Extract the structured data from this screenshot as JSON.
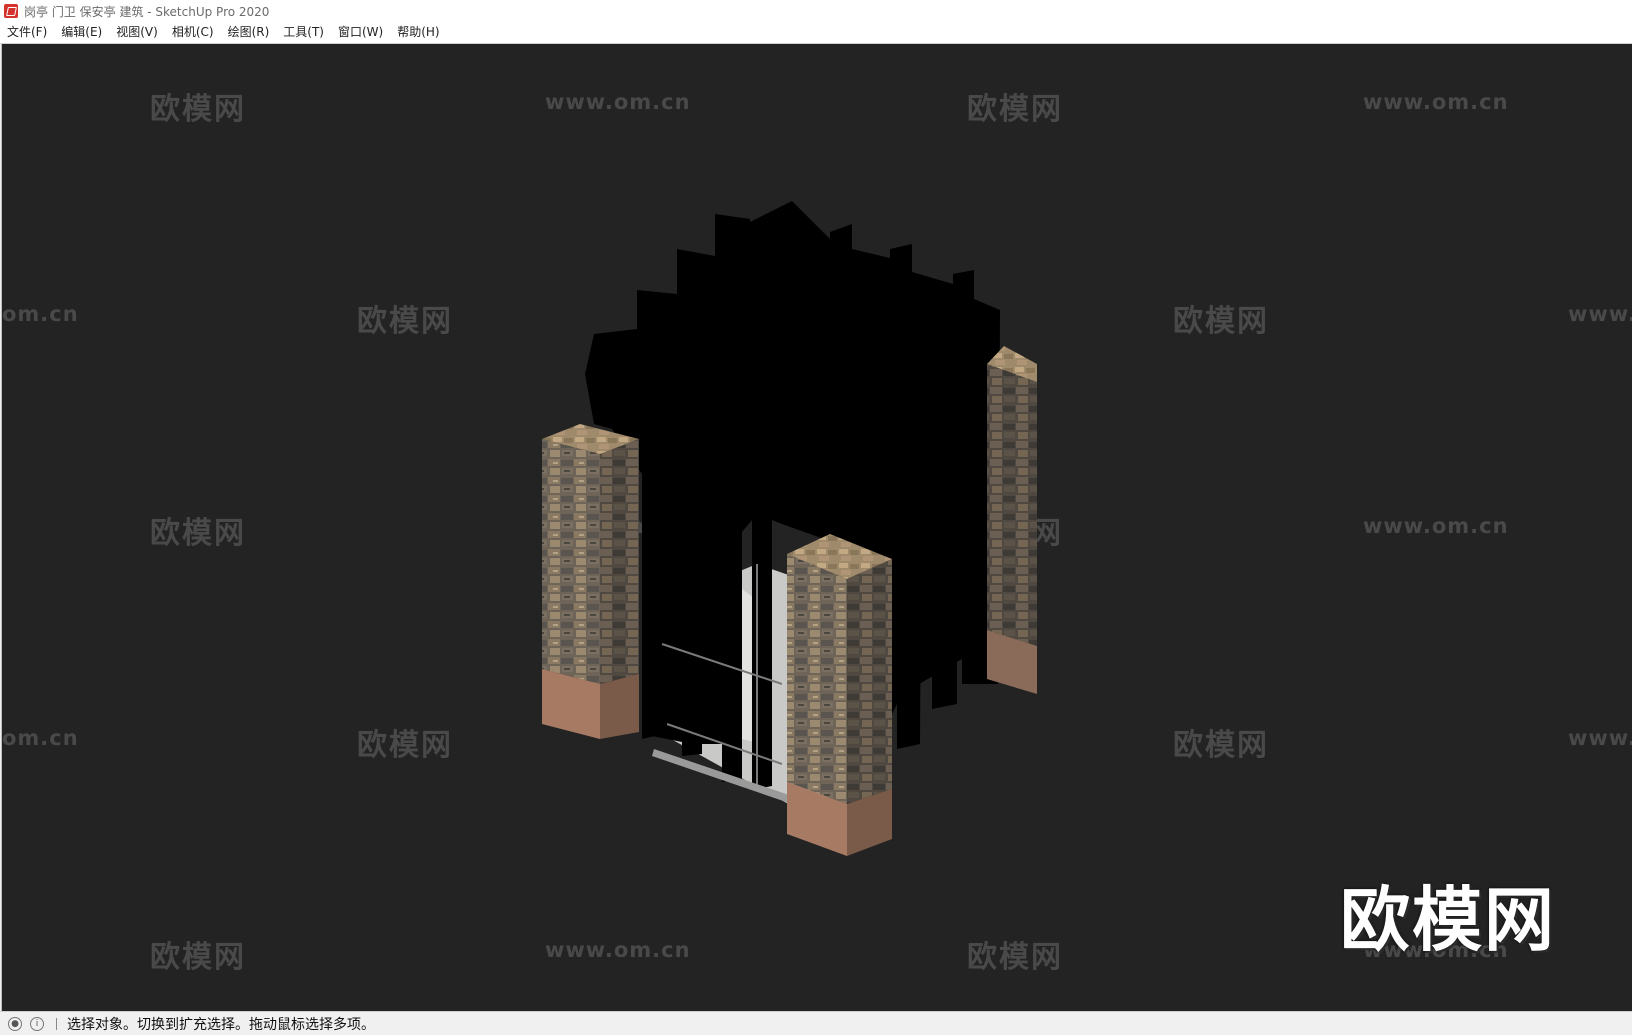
{
  "window": {
    "title": "岗亭 门卫 保安亭 建筑 - SketchUp Pro 2020"
  },
  "menu": [
    "文件(F)",
    "编辑(E)",
    "视图(V)",
    "相机(C)",
    "绘图(R)",
    "工具(T)",
    "窗口(W)",
    "帮助(H)"
  ],
  "watermarks": {
    "cn": "欧模网",
    "url": "www.om.cn",
    "url_cut": "om.cn",
    "url_edge": "www.",
    "brand": "欧模网"
  },
  "status": {
    "message": "选择对象。切换到扩充选择。拖动鼠标选择多项。"
  },
  "colors": {
    "viewport_bg": "#232323",
    "stone": "#6e6558",
    "wood": "#a77a63"
  }
}
